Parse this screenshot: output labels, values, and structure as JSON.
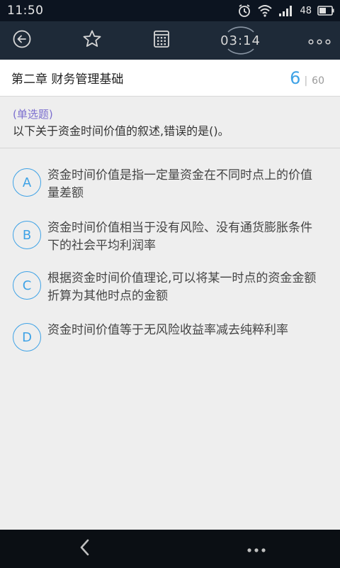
{
  "status_bar": {
    "time": "11:50",
    "battery_level": "48",
    "icons": [
      "alarm-icon",
      "wifi-icon",
      "signal-icon",
      "battery-icon"
    ]
  },
  "toolbar": {
    "timer": "03:14",
    "icons": [
      "back-circle-icon",
      "star-icon",
      "answer-sheet-icon",
      "more-icon"
    ]
  },
  "chapter": {
    "title": "第二章 财务管理基础",
    "current": "6",
    "separator": "|",
    "total": "60"
  },
  "question": {
    "type": "(单选题)",
    "text": "以下关于资金时间价值的叙述,错误的是()。"
  },
  "options": [
    {
      "letter": "A",
      "text": "资金时间价值是指一定量资金在不同时点上的价值量差额"
    },
    {
      "letter": "B",
      "text": "资金时间价值相当于没有风险、没有通货膨胀条件下的社会平均利润率"
    },
    {
      "letter": "C",
      "text": "根据资金时间价值理论,可以将某一时点的资金金额折算为其他时点的金额"
    },
    {
      "letter": "D",
      "text": "资金时间价值等于无风险收益率减去纯粹利率"
    }
  ],
  "bottom_nav": {
    "icons": [
      "chevron-left-icon",
      "more-icon"
    ]
  },
  "colors": {
    "accent": "#3ea2e6",
    "question_type": "#7c6fcf",
    "toolbar_bg": "#1e2a38",
    "status_bg": "#0c1420",
    "nav_bg": "#0b0f14"
  }
}
